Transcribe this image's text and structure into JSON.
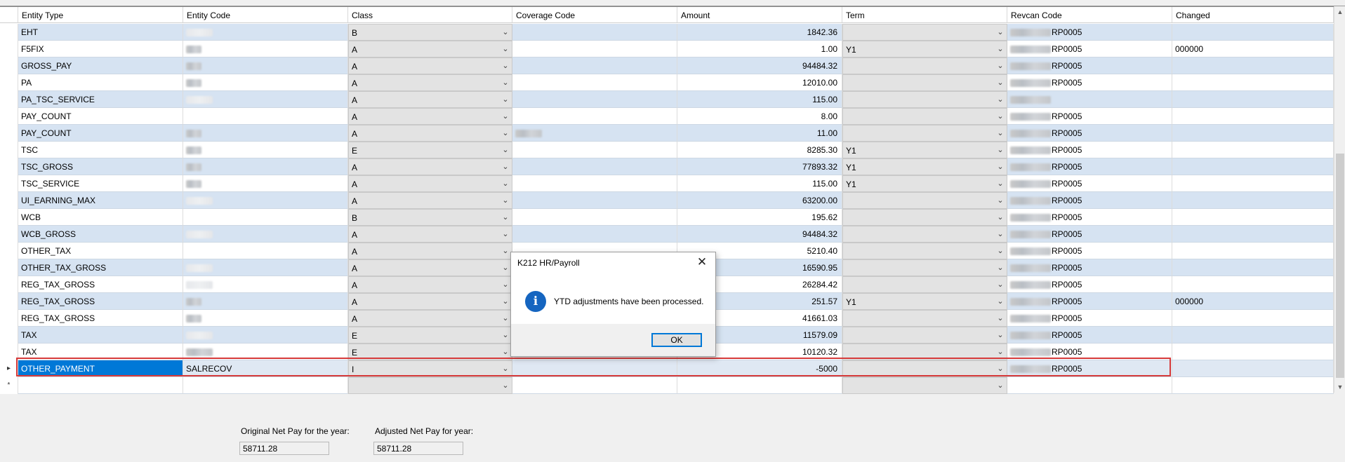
{
  "columns": [
    "Entity Type",
    "Entity Code",
    "Class",
    "Coverage Code",
    "Amount",
    "Term",
    "Revcan Code",
    "Changed"
  ],
  "rows": [
    {
      "etype": "EHT",
      "code": "",
      "class": "B",
      "coverage": "",
      "amount": "1842.36",
      "term": "",
      "revcan": "RP0005",
      "changed": ""
    },
    {
      "etype": "F5FIX",
      "code": "",
      "class": "A",
      "coverage": "",
      "amount": "1.00",
      "term": "Y1",
      "revcan": "RP0005",
      "changed": "000000"
    },
    {
      "etype": "GROSS_PAY",
      "code": "",
      "class": "A",
      "coverage": "",
      "amount": "94484.32",
      "term": "",
      "revcan": "RP0005",
      "changed": ""
    },
    {
      "etype": "PA",
      "code": "",
      "class": "A",
      "coverage": "",
      "amount": "12010.00",
      "term": "",
      "revcan": "RP0005",
      "changed": ""
    },
    {
      "etype": "PA_TSC_SERVICE",
      "code": "",
      "class": "A",
      "coverage": "",
      "amount": "115.00",
      "term": "",
      "revcan": "",
      "changed": ""
    },
    {
      "etype": "PAY_COUNT",
      "code": "",
      "class": "A",
      "coverage": "",
      "amount": "8.00",
      "term": "",
      "revcan": "RP0005",
      "changed": ""
    },
    {
      "etype": "PAY_COUNT",
      "code": "",
      "class": "A",
      "coverage": "",
      "amount": "11.00",
      "term": "",
      "revcan": "RP0005",
      "changed": ""
    },
    {
      "etype": "TSC",
      "code": "",
      "class": "E",
      "coverage": "",
      "amount": "8285.30",
      "term": "Y1",
      "revcan": "RP0005",
      "changed": ""
    },
    {
      "etype": "TSC_GROSS",
      "code": "",
      "class": "A",
      "coverage": "",
      "amount": "77893.32",
      "term": "Y1",
      "revcan": "RP0005",
      "changed": ""
    },
    {
      "etype": "TSC_SERVICE",
      "code": "",
      "class": "A",
      "coverage": "",
      "amount": "115.00",
      "term": "Y1",
      "revcan": "RP0005",
      "changed": ""
    },
    {
      "etype": "UI_EARNING_MAX",
      "code": "",
      "class": "A",
      "coverage": "",
      "amount": "63200.00",
      "term": "",
      "revcan": "RP0005",
      "changed": ""
    },
    {
      "etype": "WCB",
      "code": "",
      "class": "B",
      "coverage": "",
      "amount": "195.62",
      "term": "",
      "revcan": "RP0005",
      "changed": ""
    },
    {
      "etype": "WCB_GROSS",
      "code": "",
      "class": "A",
      "coverage": "",
      "amount": "94484.32",
      "term": "",
      "revcan": "RP0005",
      "changed": ""
    },
    {
      "etype": "OTHER_TAX",
      "code": "",
      "class": "A",
      "coverage": "",
      "amount": "5210.40",
      "term": "",
      "revcan": "RP0005",
      "changed": ""
    },
    {
      "etype": "OTHER_TAX_GROSS",
      "code": "",
      "class": "A",
      "coverage": "",
      "amount": "16590.95",
      "term": "",
      "revcan": "RP0005",
      "changed": ""
    },
    {
      "etype": "REG_TAX_GROSS",
      "code": "",
      "class": "A",
      "coverage": "",
      "amount": "26284.42",
      "term": "",
      "revcan": "RP0005",
      "changed": ""
    },
    {
      "etype": "REG_TAX_GROSS",
      "code": "",
      "class": "A",
      "coverage": "",
      "amount": "251.57",
      "term": "Y1",
      "revcan": "RP0005",
      "changed": "000000"
    },
    {
      "etype": "REG_TAX_GROSS",
      "code": "",
      "class": "A",
      "coverage": "",
      "amount": "41661.03",
      "term": "",
      "revcan": "RP0005",
      "changed": ""
    },
    {
      "etype": "TAX",
      "code": "",
      "class": "E",
      "coverage": "",
      "amount": "11579.09",
      "term": "",
      "revcan": "RP0005",
      "changed": ""
    },
    {
      "etype": "TAX",
      "code": "",
      "class": "E",
      "coverage": "",
      "amount": "10120.32",
      "term": "",
      "revcan": "RP0005",
      "changed": ""
    },
    {
      "etype": "OTHER_PAYMENT",
      "code": "SALRECOV",
      "class": "I",
      "coverage": "",
      "amount": "-5000",
      "term": "",
      "revcan": "RP0005",
      "changed": ""
    },
    {
      "etype": "",
      "code": "",
      "class": "",
      "coverage": "",
      "amount": "",
      "term": "",
      "revcan": "",
      "changed": ""
    }
  ],
  "row_headers": {
    "selected": "▸",
    "new": "*"
  },
  "dialog": {
    "title": "K212 HR/Payroll",
    "message": "YTD adjustments have been processed.",
    "ok": "OK",
    "close": "✕",
    "info": "i"
  },
  "footer": {
    "original_label": "Original Net Pay for the year:",
    "original_value": "58711.28",
    "adjusted_label": "Adjusted Net Pay for year:",
    "adjusted_value": "58711.28"
  },
  "icons": {
    "dropdown": "chevron-down-icon",
    "scroll_up": "▲",
    "scroll_down": "▼"
  },
  "colors": {
    "alt_row": "#d6e3f2",
    "selection": "#0078d7",
    "highlight": "#d63a3a",
    "info": "#1565c0"
  }
}
